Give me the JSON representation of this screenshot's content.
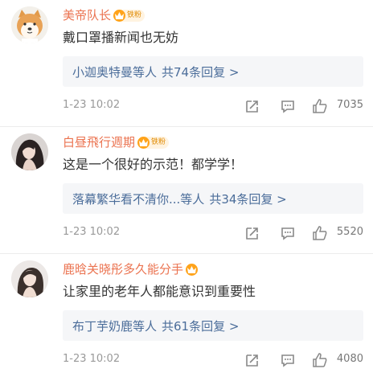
{
  "comments": [
    {
      "username": "美帝队长",
      "badge": "铁粉",
      "text": "戴口罩播新闻也无妨",
      "reply_users": "小迦奥特曼等人",
      "reply_count": "共74条回复 >",
      "time": "1-23 10:02",
      "likes": "7035",
      "avatar_icon": "shiba-dog-avatar"
    },
    {
      "username": "白昼飛行週期",
      "badge": "铁粉",
      "text": "这是一个很好的示范！都学学！",
      "reply_users": "落幕繁华看不清你...等人",
      "reply_count": "共34条回复 >",
      "time": "1-23 10:02",
      "likes": "5520",
      "avatar_icon": "woman-portrait-avatar"
    },
    {
      "username": "鹿晗关晓彤多久能分手",
      "badge": "",
      "text": "让家里的老年人都能意识到重要性",
      "reply_users": "布丁芋奶鹿等人",
      "reply_count": "共61条回复 >",
      "time": "1-23 10:02",
      "likes": "4080",
      "avatar_icon": "woman-portrait-avatar"
    }
  ],
  "colors": {
    "username": "#eb7350",
    "reply_link": "#4b6d9a",
    "badge": "#ffa31a"
  }
}
